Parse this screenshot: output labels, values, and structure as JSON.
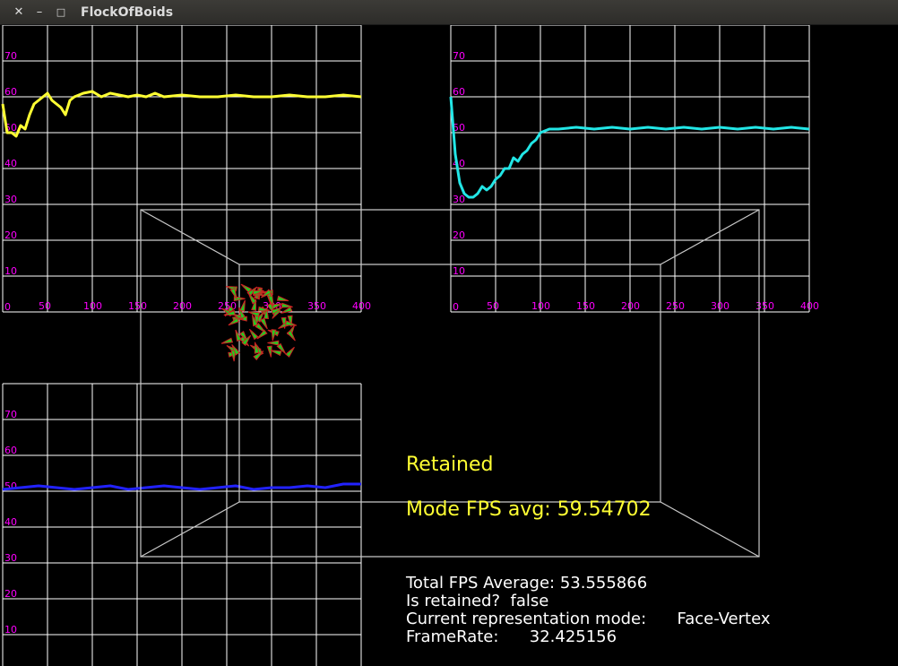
{
  "window": {
    "title": "FlockOfBoids",
    "close_glyph": "✕",
    "minimize_glyph": "–",
    "maximize_glyph": "□"
  },
  "overlay": {
    "mode_label": "Retained",
    "mode_fps": "Mode FPS avg: 59.54702",
    "total_fps": "Total FPS Average: 53.555866",
    "is_retained": "Is retained?  false",
    "representation": "Current representation mode:      Face-Vertex",
    "framerate": "FrameRate:      32.425156"
  },
  "colors": {
    "grid": "#ffffff",
    "tick_label": "#ff00ff",
    "mode_text": "#ffff33",
    "info_text": "#ffffff",
    "box_edges": "#c8c8c8",
    "boid_fill": "#22cc22",
    "boid_edge": "#cc2222"
  },
  "chart_data": [
    {
      "type": "line",
      "position_word": "top-left",
      "series_color": "#ffff33",
      "xticks": [
        50,
        100,
        150,
        200,
        250,
        300,
        350,
        400
      ],
      "yticks": [
        0,
        10,
        20,
        30,
        40,
        50,
        60,
        70
      ],
      "xlim": [
        0,
        400
      ],
      "ylim": [
        0,
        80
      ],
      "x": [
        0,
        5,
        10,
        15,
        20,
        25,
        30,
        35,
        40,
        45,
        50,
        55,
        60,
        65,
        70,
        75,
        80,
        90,
        100,
        110,
        120,
        130,
        140,
        150,
        160,
        170,
        180,
        200,
        220,
        240,
        260,
        280,
        300,
        320,
        340,
        360,
        380,
        400
      ],
      "values": [
        58,
        50,
        50,
        49,
        52,
        51,
        55,
        58,
        59,
        60,
        61,
        59,
        58,
        57,
        55,
        59,
        60,
        61,
        61.5,
        60,
        61,
        60.5,
        60,
        60.5,
        60,
        61,
        60,
        60.5,
        60,
        60,
        60.5,
        60,
        60,
        60.5,
        60,
        60,
        60.5,
        60
      ]
    },
    {
      "type": "line",
      "position_word": "top-right",
      "series_color": "#22e6e6",
      "xticks": [
        50,
        100,
        150,
        200,
        250,
        300,
        350,
        400
      ],
      "yticks": [
        0,
        10,
        20,
        30,
        40,
        50,
        60,
        70
      ],
      "xlim": [
        0,
        400
      ],
      "ylim": [
        0,
        80
      ],
      "x": [
        0,
        5,
        10,
        15,
        20,
        25,
        30,
        35,
        40,
        45,
        50,
        55,
        60,
        65,
        70,
        75,
        80,
        85,
        90,
        95,
        100,
        110,
        120,
        140,
        160,
        180,
        200,
        220,
        240,
        260,
        280,
        300,
        320,
        340,
        360,
        380,
        400
      ],
      "values": [
        60,
        44,
        36,
        33,
        32,
        32,
        33,
        35,
        34,
        35,
        37,
        38,
        40,
        40,
        43,
        42,
        44,
        45,
        47,
        48,
        50,
        51,
        51,
        51.5,
        51,
        51.5,
        51,
        51.5,
        51,
        51.5,
        51,
        51.5,
        51,
        51.5,
        51,
        51.5,
        51
      ]
    },
    {
      "type": "line",
      "position_word": "bottom-left",
      "series_color": "#2222ff",
      "xticks": [
        50,
        100,
        150,
        200,
        250,
        300,
        350,
        400
      ],
      "yticks": [
        0,
        10,
        20,
        30,
        40,
        50,
        60,
        70
      ],
      "xlim": [
        0,
        400
      ],
      "ylim": [
        0,
        80
      ],
      "x": [
        0,
        20,
        40,
        60,
        80,
        100,
        120,
        140,
        160,
        180,
        200,
        220,
        240,
        260,
        280,
        300,
        320,
        340,
        360,
        380,
        400
      ],
      "values": [
        50.5,
        51,
        51.5,
        51,
        50.5,
        51,
        51.5,
        50.5,
        51,
        51.5,
        51,
        50.5,
        51,
        51.5,
        50.5,
        51,
        51,
        51.5,
        51,
        52,
        52
      ]
    }
  ]
}
